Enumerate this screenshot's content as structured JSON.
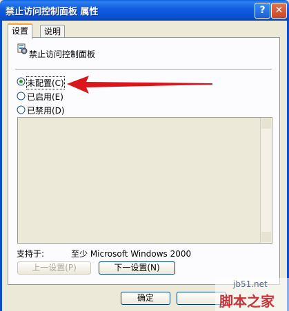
{
  "window": {
    "title": "禁止访问控制面板 属性",
    "help_glyph": "?",
    "close_glyph": "✕"
  },
  "tabs": [
    {
      "label": "设置"
    },
    {
      "label": "说明"
    }
  ],
  "policy": {
    "name": "禁止访问控制面板",
    "icon": "policy-icon"
  },
  "options": [
    {
      "label": "未配置(C)",
      "selected": true
    },
    {
      "label": "已启用(E)",
      "selected": false
    },
    {
      "label": "已禁用(D)",
      "selected": false
    }
  ],
  "support": {
    "label": "支持于:",
    "value": "至少 Microsoft Windows 2000"
  },
  "buttons": {
    "prev": "上一设置(P)",
    "next": "下一设置(N)",
    "ok": "确定"
  },
  "watermark": {
    "site": "jb51.net",
    "brand": "脚本之家"
  },
  "colors": {
    "title_bar": "#0b4fcf",
    "dialog_bg": "#ece9d8",
    "annotation_arrow": "#d8161c"
  }
}
